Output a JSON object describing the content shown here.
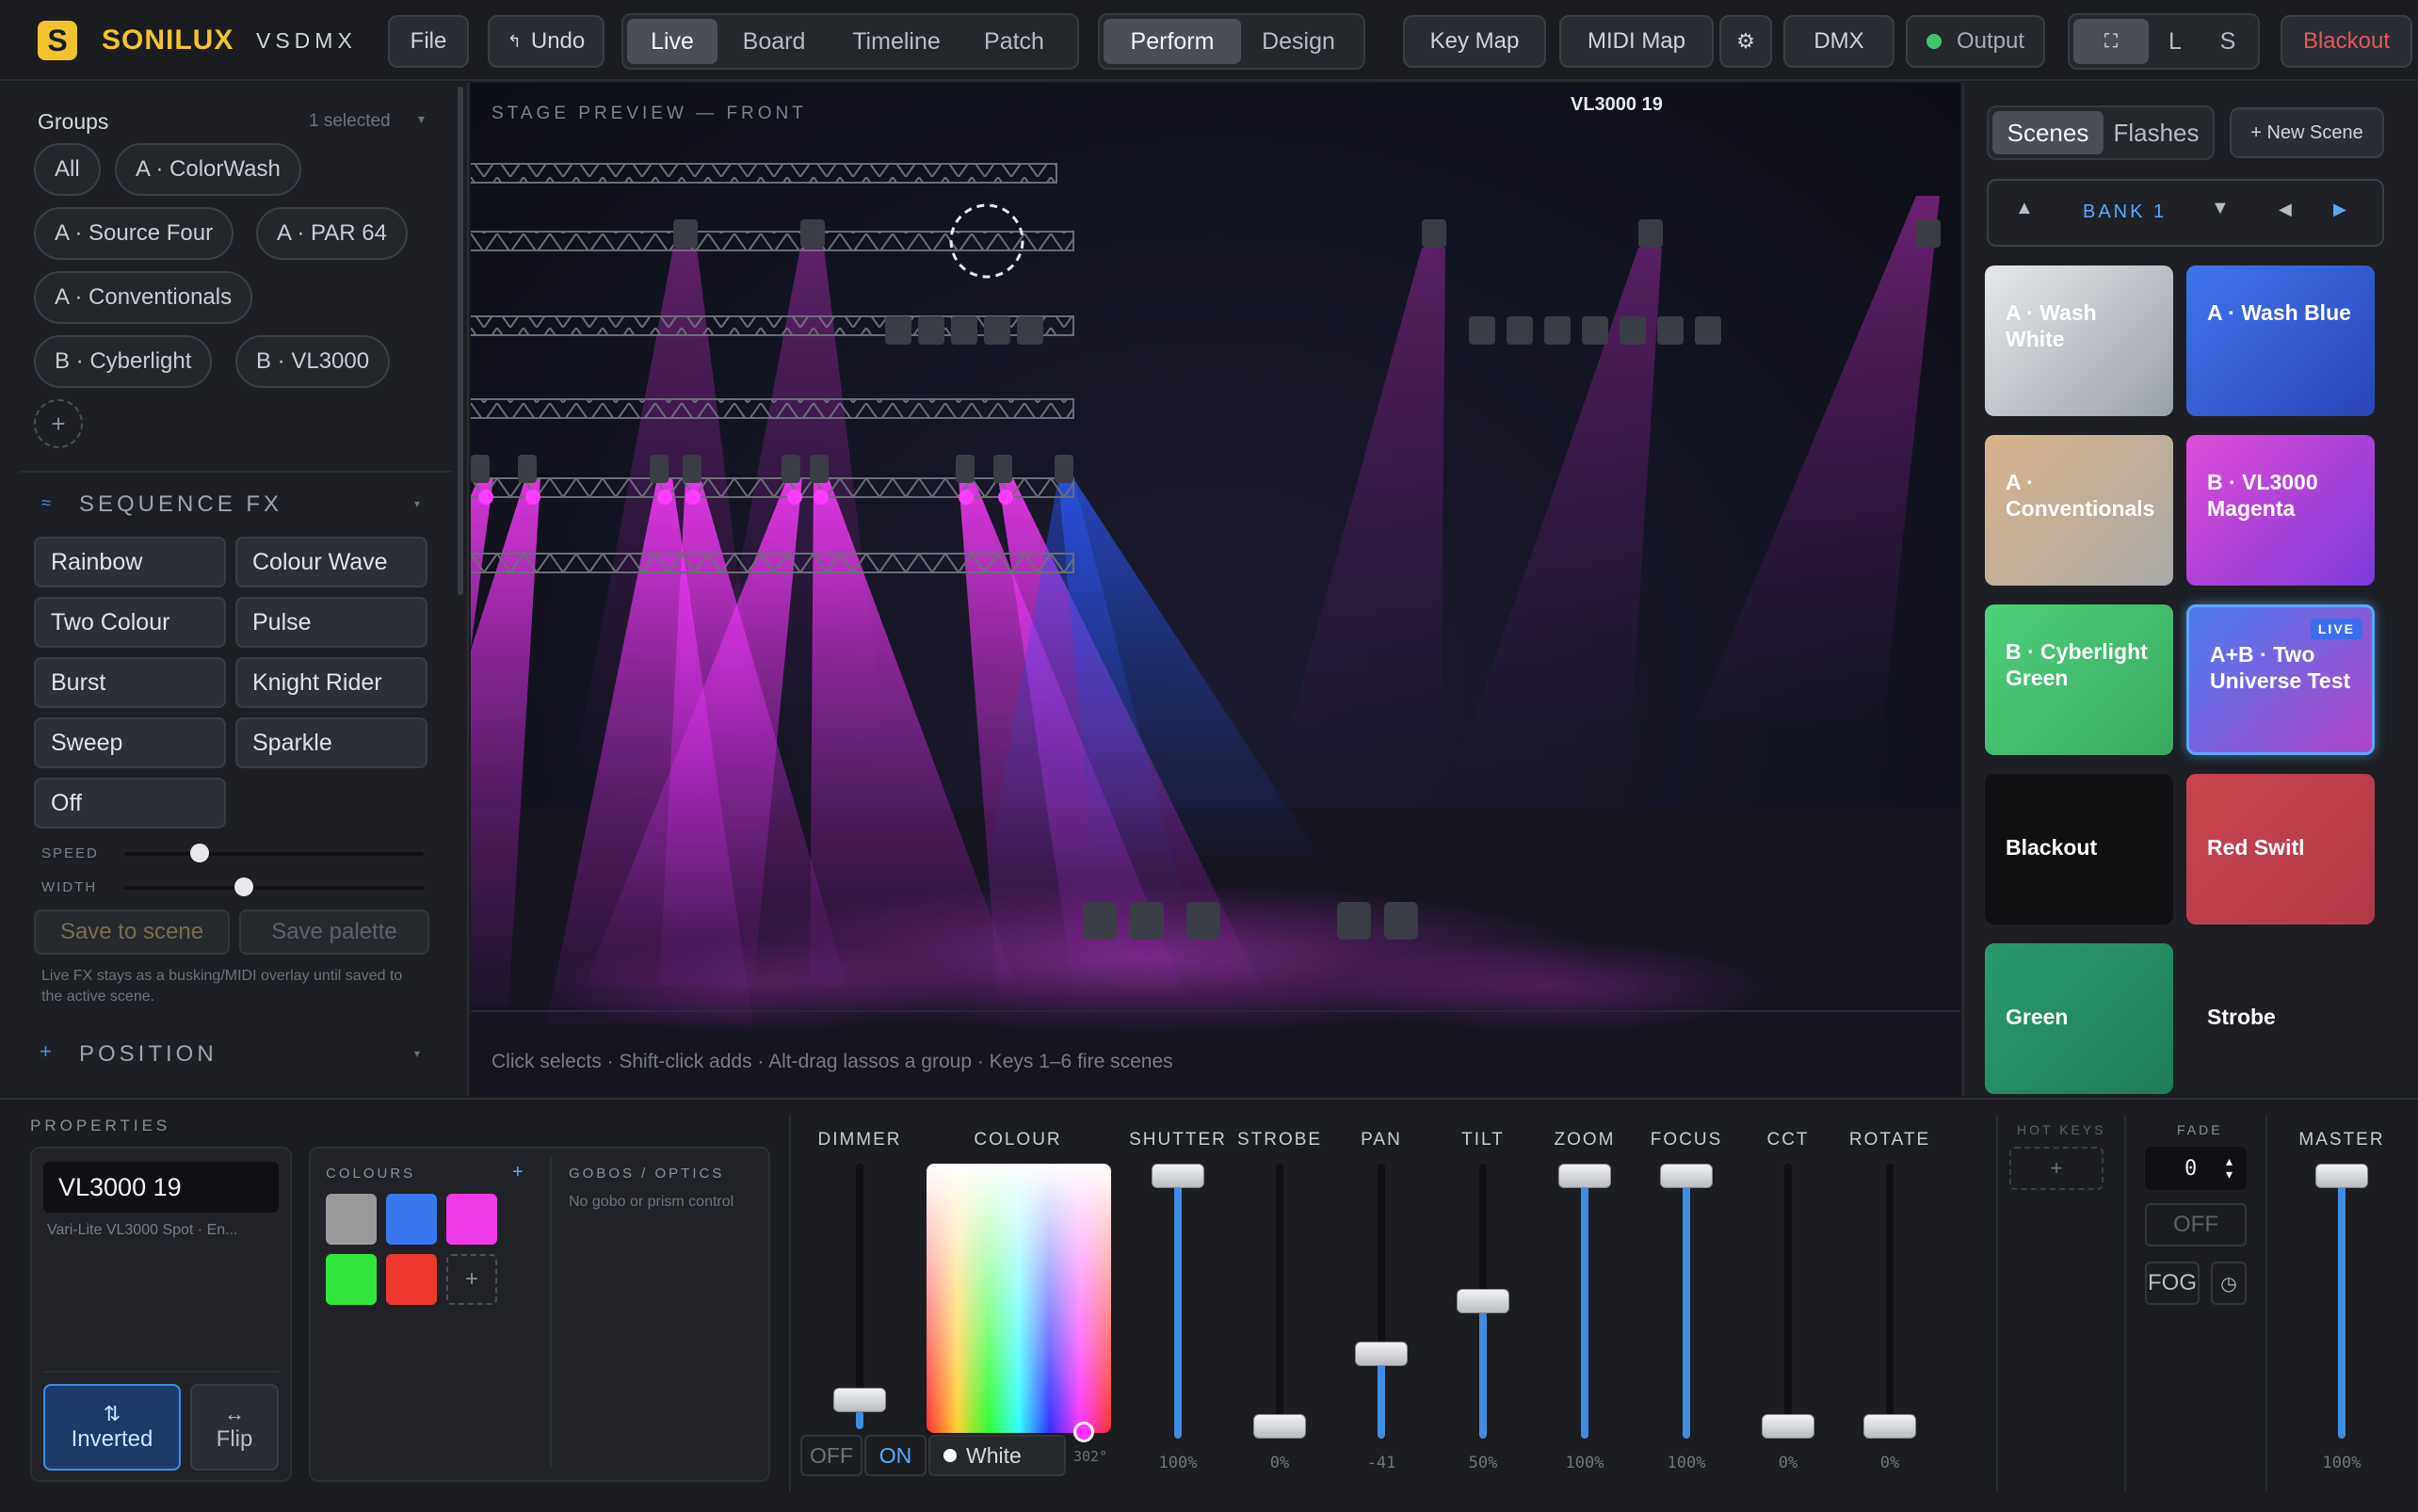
{
  "app": {
    "brand": "SONILUX",
    "sub": "VSDMX"
  },
  "toolbar": {
    "file": "File",
    "undo": "Undo",
    "views": [
      "Live",
      "Board",
      "Timeline",
      "Patch"
    ],
    "modes": [
      "Perform",
      "Design"
    ],
    "keymap": "Key Map",
    "midimap": "MIDI Map",
    "dmx": "DMX",
    "output": "Output",
    "layout": [
      "L",
      "S"
    ],
    "blackout": "Blackout"
  },
  "groups": {
    "title": "Groups",
    "selected": "1 selected",
    "items": [
      "All",
      "A · ColorWash",
      "A · Source Four",
      "A · PAR 64",
      "A · Conventionals",
      "B · Cyberlight",
      "B · VL3000"
    ]
  },
  "sequence_fx": {
    "title": "SEQUENCE FX",
    "items": [
      "Rainbow",
      "Colour Wave",
      "Two Colour",
      "Pulse",
      "Burst",
      "Knight Rider",
      "Sweep",
      "Sparkle",
      "Off"
    ],
    "speed_label": "SPEED",
    "width_label": "WIDTH",
    "speed": 0.25,
    "width": 0.4,
    "save_scene": "Save to scene",
    "save_palette": "Save palette",
    "note": "Live FX stays as a busking/MIDI overlay until saved to the active scene."
  },
  "position": {
    "title": "POSITION"
  },
  "stage": {
    "title": "STAGE PREVIEW — FRONT",
    "selected_fixture": "VL3000 19",
    "hint": "Click selects · Shift-click adds · Alt-drag lassos a group · Keys 1–6 fire scenes"
  },
  "scenes": {
    "tabs": [
      "Scenes",
      "Flashes"
    ],
    "new_scene": "+ New Scene",
    "bank": "BANK 1",
    "items": [
      {
        "name": "A · Wash White",
        "bg": "linear-gradient(135deg,#e6e8eb,#9aa0a8)"
      },
      {
        "name": "A · Wash Blue",
        "bg": "linear-gradient(135deg,#3f74ee,#2a46b8)"
      },
      {
        "name": "A · Conventionals",
        "bg": "linear-gradient(135deg,#d8b48a,#a9a9a9)"
      },
      {
        "name": "B · VL3000 Magenta",
        "bg": "linear-gradient(135deg,#e04bd8,#7a3bd8)"
      },
      {
        "name": "B · Cyberlight Green",
        "bg": "linear-gradient(135deg,#4fd07a,#3aa95f)"
      },
      {
        "name": "A+B · Two Universe Test",
        "bg": "linear-gradient(135deg,#4a7cf0,#b245c8)",
        "live": "LIVE"
      },
      {
        "name": "Blackout",
        "bg": "#0f1012"
      },
      {
        "name": "Red Switl",
        "bg": "linear-gradient(135deg,#c8444f,#b03a48)"
      },
      {
        "name": "Green",
        "bg": "linear-gradient(135deg,#2a9a6e,#1f7d5a)"
      },
      {
        "name": "Strobe",
        "bg": "#1d1f23"
      }
    ]
  },
  "properties": {
    "title": "PROPERTIES",
    "fixture": "VL3000 19",
    "desc": "Vari-Lite VL3000 Spot · En...",
    "inverted": "Inverted",
    "flip": "Flip",
    "colours_title": "COLOURS",
    "gobos_title": "GOBOS / OPTICS",
    "gobos_note": "No gobo or prism control",
    "swatches": [
      "#9a9a9a",
      "#3a78f0",
      "#f03ae8",
      "#33e63e",
      "#ee3a2e"
    ]
  },
  "faders": {
    "dimmer": {
      "label": "DIMMER",
      "value": 0.07
    },
    "colour": {
      "label": "COLOUR",
      "off": "OFF",
      "on": "ON",
      "name": "White",
      "deg": "302°"
    },
    "channels": [
      {
        "label": "SHUTTER",
        "value": 1.0,
        "text": "100%"
      },
      {
        "label": "STROBE",
        "value": 0.0,
        "text": "0%"
      },
      {
        "label": "PAN",
        "value": 0.29,
        "text": "-41"
      },
      {
        "label": "TILT",
        "value": 0.5,
        "text": "50%"
      },
      {
        "label": "ZOOM",
        "value": 1.0,
        "text": "100%"
      },
      {
        "label": "FOCUS",
        "value": 1.0,
        "text": "100%"
      },
      {
        "label": "CCT",
        "value": 0.0,
        "text": "0%"
      },
      {
        "label": "ROTATE",
        "value": 0.0,
        "text": "0%"
      }
    ],
    "hotkeys": "HOT KEYS",
    "fade_label": "FADE",
    "fade_value": "0",
    "off": "OFF",
    "fog": "FOG",
    "master": {
      "label": "MASTER",
      "value": 1.0,
      "text": "100%"
    }
  },
  "colors": {
    "accent": "#3f8de0",
    "brand": "#f2c230",
    "live_border": "#5aa8ff",
    "blackout": "#e05a5a",
    "output_led": "#3ec46b"
  }
}
